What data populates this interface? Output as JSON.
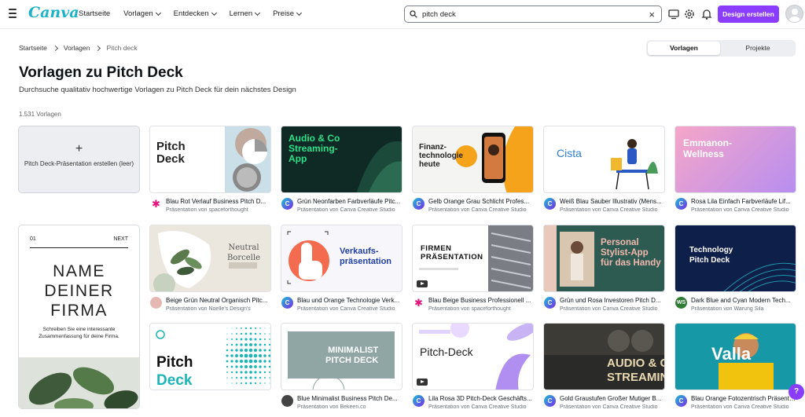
{
  "header": {
    "logo": "Canva",
    "nav": [
      {
        "label": "Startseite",
        "dropdown": false
      },
      {
        "label": "Vorlagen",
        "dropdown": true
      },
      {
        "label": "Entdecken",
        "dropdown": true
      },
      {
        "label": "Lernen",
        "dropdown": true
      },
      {
        "label": "Preise",
        "dropdown": true
      }
    ],
    "search_value": "pitch deck",
    "cta": "Design erstellen",
    "icons": [
      "monitor-icon",
      "gear-icon",
      "bell-icon"
    ]
  },
  "breadcrumb": [
    "Startseite",
    "Vorlagen",
    "Pitch deck"
  ],
  "toggle": {
    "active": "Vorlagen",
    "inactive": "Projekte"
  },
  "page": {
    "title": "Vorlagen zu Pitch Deck",
    "subtitle": "Durchsuche qualitativ hochwertige Vorlagen zu Pitch Deck für dein nächstes Design",
    "count": "1.531 Vorlagen"
  },
  "create_card": {
    "plus": "+",
    "label": "Pitch Deck-Präsentation erstellen (leer)"
  },
  "tall_card": {
    "num": "01",
    "next": "NEXT",
    "title_lines": [
      "NAME",
      "DEINER",
      "FIRMA"
    ],
    "text": "Schreiben Sie eine interessante Zusammenfassung für deine Firma."
  },
  "templates": [
    {
      "title": "Blau Rot Verlauf Business Pitch D...",
      "by": "Präsentation von spaceforthought",
      "icon": "star",
      "thumb_text": [
        "Pitch",
        "Deck"
      ]
    },
    {
      "title": "Grün Neonfarben Farbverläufe Pitc...",
      "by": "Präsentation von Canva Creative Studio",
      "icon": "canva",
      "thumb_text": [
        "Audio & Co",
        "Streaming-",
        "App"
      ]
    },
    {
      "title": "Gelb Orange Grau Schlicht Profes...",
      "by": "Präsentation von Canva Creative Studio",
      "icon": "canva",
      "thumb_text": [
        "Finanz-",
        "technologie",
        "heute"
      ]
    },
    {
      "title": "Weiß Blau Sauber Illustrativ (Mens...",
      "by": "Präsentation von Canva Creative Studio",
      "icon": "canva",
      "thumb_text": [
        "Cista"
      ]
    },
    {
      "title": "Rosa Lila Einfach Farbverläufe Lif...",
      "by": "Präsentation von Canva Creative Studio",
      "icon": "canva",
      "thumb_text": [
        "Emmanon-",
        "Wellness"
      ]
    },
    {
      "title": "Beige Grün Neutral Organisch Pitc...",
      "by": "Präsentation von Noelle's Design's",
      "icon": "face",
      "thumb_text": [
        "Neutral",
        "Borcelle"
      ]
    },
    {
      "title": "Blau und Orange Technologie Verk...",
      "by": "Präsentation von Canva Creative Studio",
      "icon": "canva",
      "thumb_text": [
        "Verkaufs-",
        "präsentation"
      ]
    },
    {
      "title": "Blau Beige Business Professionell ...",
      "by": "Präsentation von spaceforthought",
      "icon": "star",
      "thumb_text": [
        "FIRMEN",
        "PRÄSENTATION"
      ]
    },
    {
      "title": "Grün und Rosa Investoren Pitch D...",
      "by": "Präsentation von Canva Creative Studio",
      "icon": "canva",
      "thumb_text": [
        "Personal",
        "Stylist-App",
        "für das Handy"
      ]
    },
    {
      "title": "Dark Blue and Cyan Modern Tech...",
      "by": "Präsentation von Warung Sila",
      "icon": "ws",
      "thumb_text": [
        "Technology",
        "Pitch Deck"
      ]
    },
    {
      "title": "",
      "by": "",
      "icon": "",
      "thumb_text": [
        "Pitch",
        "Deck"
      ]
    },
    {
      "title": "Blue Minimalist Business Pitch De...",
      "by": "Präsentation von Bekeen.co",
      "icon": "bk",
      "thumb_text": [
        "MINIMALIST",
        "PITCH DECK"
      ]
    },
    {
      "title": "Lila Rosa 3D Pitch-Deck Geschäfts...",
      "by": "Präsentation von Canva Creative Studio",
      "icon": "canva",
      "thumb_text": [
        "Pitch-Deck"
      ]
    },
    {
      "title": "Gold Graustufen Großer Mutiger B...",
      "by": "Präsentation von Canva Creative Studio",
      "icon": "canva",
      "thumb_text": [
        "AUDIO & CO",
        "STREAMING-APP"
      ]
    },
    {
      "title": "Blau Orange Fotozentrisch Präsenta...",
      "by": "Präsentation von Canva Creative Studio",
      "icon": "canva",
      "thumb_text": [
        "Valla"
      ]
    }
  ],
  "help": "?"
}
